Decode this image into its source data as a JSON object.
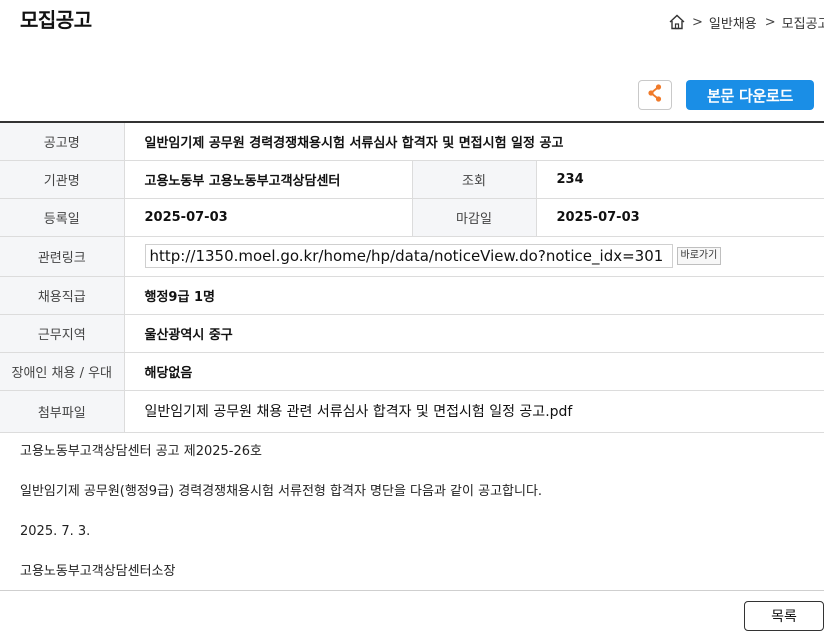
{
  "header": {
    "title": "모집공고",
    "breadcrumb": {
      "sep": ">",
      "items": [
        "일반채용",
        "모집공고"
      ]
    }
  },
  "actions": {
    "download_label": "본문 다운로드",
    "share_icon": "share-icon"
  },
  "info": {
    "title_label": "공고명",
    "title_value": "일반임기제 공무원 경력경쟁채용시험 서류심사 합격자 및 면접시험 일정 공고",
    "agency_label": "기관명",
    "agency_value": "고용노동부 고용노동부고객상담센터",
    "views_label": "조회",
    "views_value": "234",
    "reg_label": "등록일",
    "reg_value": "2025-07-03",
    "deadline_label": "마감일",
    "deadline_value": "2025-07-03",
    "link_label": "관련링크",
    "link_value": "http://1350.moel.go.kr/home/hp/data/noticeView.do?notice_idx=301",
    "go_label": "바로가기",
    "job_label": "채용직급",
    "job_value": "행정9급 1명",
    "region_label": "근무지역",
    "region_value": "울산광역시 중구",
    "disabled_label": "장애인 채용 / 우대",
    "disabled_value": "해당없음",
    "file_label": "첨부파일",
    "file_value": "일반임기제 공무원 채용 관련 서류심사 합격자 및 면접시험 일정 공고.pdf"
  },
  "body": {
    "line1": "고용노동부고객상담센터 공고 제2025-26호",
    "line2": "일반임기제 공무원(행정9급) 경력경쟁채용시험 서류전형 합격자 명단을 다음과 같이 공고합니다.",
    "line3": "2025. 7. 3.",
    "line4": "고용노동부고객상담센터소장"
  },
  "footer": {
    "list_label": "목록"
  }
}
